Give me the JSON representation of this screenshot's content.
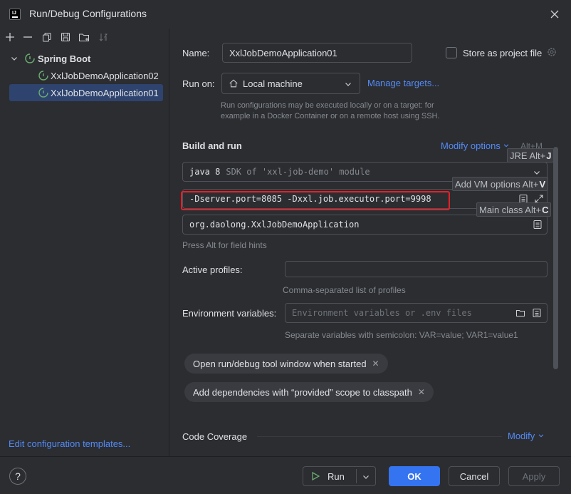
{
  "window": {
    "title": "Run/Debug Configurations"
  },
  "tree": {
    "group": "Spring Boot",
    "items": [
      "XxlJobDemoApplication02",
      "XxlJobDemoApplication01"
    ],
    "edit_templates": "Edit configuration templates..."
  },
  "form": {
    "name_label": "Name:",
    "name_value": "XxlJobDemoApplication01",
    "store_label": "Store as project file",
    "run_on_label": "Run on:",
    "run_on_value": "Local machine",
    "manage_targets": "Manage targets...",
    "run_on_hint_1": "Run configurations may be executed locally or on a target: for",
    "run_on_hint_2": "example in a Docker Container or on a remote host using SSH.",
    "build_and_run": "Build and run",
    "modify_options": "Modify options",
    "modify_shortcut": "Alt+M",
    "jre_value": "java 8",
    "jre_sdk": "SDK of 'xxl-job-demo' module",
    "vm_options_value": "-Dserver.port=8085 -Dxxl.job.executor.port=9998",
    "main_class_value": "org.daolong.XxlJobDemoApplication",
    "field_hints": "Press Alt for field hints",
    "active_profiles_label": "Active profiles:",
    "active_profiles_hint": "Comma-separated list of profiles",
    "env_label": "Environment variables:",
    "env_placeholder": "Environment variables or .env files",
    "env_hint": "Separate variables with semicolon: VAR=value; VAR1=value1",
    "chip_1": "Open run/debug tool window when started",
    "chip_2": "Add dependencies with “provided” scope to classpath",
    "code_coverage": "Code Coverage",
    "modify": "Modify"
  },
  "tooltips": {
    "jre_text": "JRE Alt+",
    "jre_key": "J",
    "vm_text": "Add VM options Alt+",
    "vm_key": "V",
    "main_text": "Main class Alt+",
    "main_key": "C"
  },
  "buttons": {
    "help": "?",
    "run": "Run",
    "ok": "OK",
    "cancel": "Cancel",
    "apply": "Apply"
  },
  "colors": {
    "accent": "#3574f0",
    "link": "#548af7",
    "highlight_box": "#e5202a",
    "spring_green": "#6aab73"
  }
}
